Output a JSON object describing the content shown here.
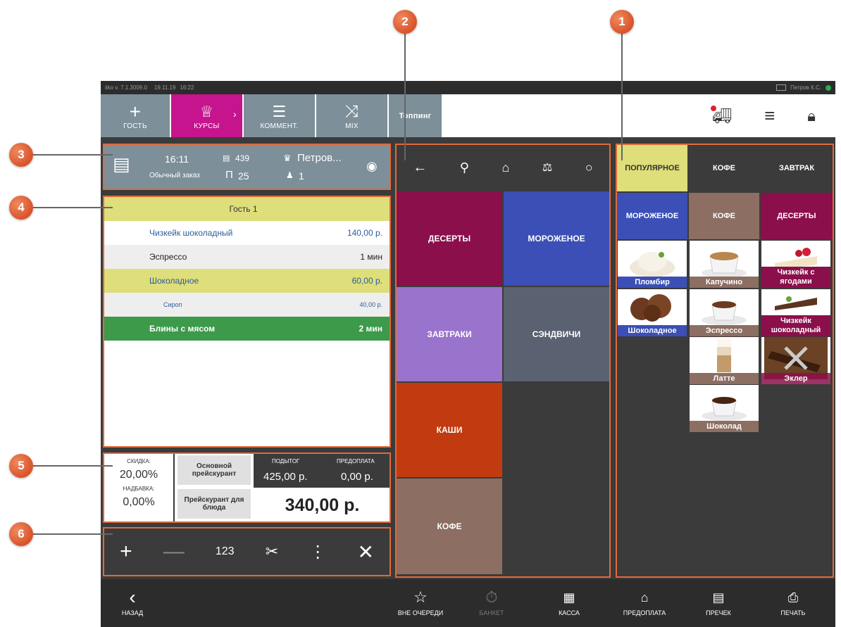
{
  "callouts": [
    "1",
    "2",
    "3",
    "4",
    "5",
    "6"
  ],
  "status": {
    "version": "iiko  v. 7.1.3009.0",
    "date": "19.11.19",
    "time": "16:22",
    "user": "Петров К.С."
  },
  "toolbar": {
    "guest_label": "ГОСТЬ",
    "courses_label": "КУРСЫ",
    "comment_label": "КОММЕНТ.",
    "mix_label": "MIX",
    "topping_label": "Топпинг",
    "icons": [
      "truck-icon",
      "menu-icon",
      "lock-icon"
    ]
  },
  "order": {
    "time": "16:11",
    "order_type": "Обычный заказ",
    "number": "439",
    "table": "25",
    "waiter": "Петров...",
    "guests": "1"
  },
  "order_items": {
    "guest": "Гость 1",
    "rows": [
      {
        "name": "Чизкейк шоколадный",
        "value": "140,00 р."
      },
      {
        "name": "Эспрессо",
        "value": "1 мин"
      },
      {
        "name": "Шоколадное",
        "value": "60,00 р."
      },
      {
        "name": "Сироп",
        "value": "40,00 р."
      },
      {
        "name": "Блины с мясом",
        "value": "2 мин"
      }
    ]
  },
  "totals": {
    "discount_label": "СКИДКА:",
    "discount_value": "20,00%",
    "markup_label": "НАДБАВКА:",
    "markup_value": "0,00%",
    "main_price_btn": "Основной прейскурант",
    "dish_price_btn": "Прейскурант для блюда",
    "subtotal_label": "ПОДЫТОГ",
    "subtotal_value": "425,00 р.",
    "prepay_label": "ПРЕДОПЛАТА",
    "prepay_value": "0,00 р.",
    "total_value": "340,00 р."
  },
  "actions": {
    "qty_label": "123"
  },
  "categories": [
    "ДЕСЕРТЫ",
    "МОРОЖЕНОЕ",
    "ЗАВТРАКИ",
    "СЭНДВИЧИ",
    "КАШИ",
    "КОФЕ"
  ],
  "menu": {
    "tabs": [
      "ПОПУЛЯРНОЕ",
      "КОФЕ",
      "ЗАВТРАК"
    ],
    "groups": [
      "МОРОЖЕНОЕ",
      "КОФЕ",
      "ДЕСЕРТЫ"
    ],
    "products": [
      "Пломбир",
      "Капучино",
      "Чизкейк с ягодами",
      "Шоколадное",
      "Эспрессо",
      "Чизкейк шоколадный",
      "Латте",
      "Эклер",
      "Шоколад"
    ]
  },
  "bottomnav": {
    "back": "НАЗАД",
    "queue": "ВНЕ ОЧЕРЕДИ",
    "banquet": "БАНКЕТ",
    "cash": "КАССА",
    "prepay": "ПРЕДОПЛАТА",
    "precheck": "ПРЕЧЕК",
    "print": "ПЕЧАТЬ"
  },
  "colors": {
    "accent_pink": "#c5148d",
    "toolbar_grey": "#7d8f99",
    "callout_orange": "#e06a3b",
    "guest_yellow": "#dede7a",
    "green_row": "#3c9a4a"
  }
}
